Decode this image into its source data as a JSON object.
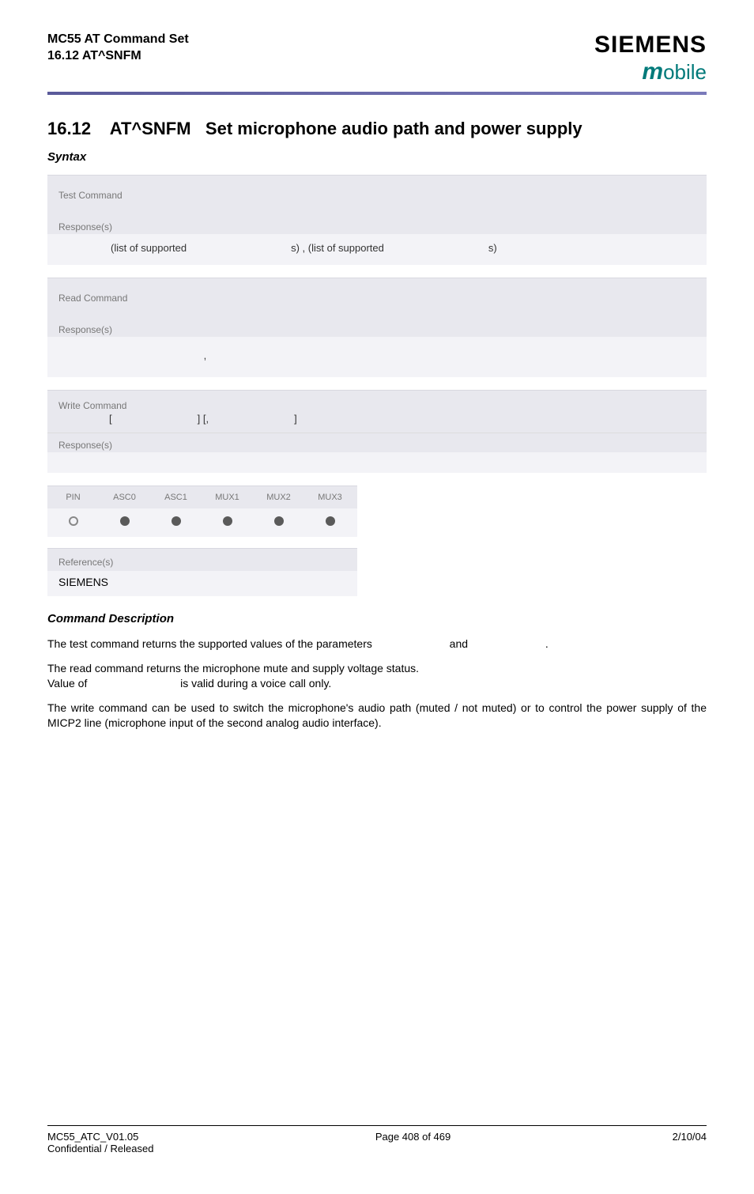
{
  "header": {
    "title_line1": "MC55 AT Command Set",
    "title_line2": "16.12 AT^SNFM",
    "brand": "SIEMENS",
    "subbrand_m": "m",
    "subbrand_rest": "obile"
  },
  "section": {
    "number": "16.12",
    "cmd": "AT^SNFM",
    "title_rest": "Set microphone audio path and power supply"
  },
  "labels": {
    "syntax": "Syntax",
    "test_command": "Test Command",
    "response": "Response(s)",
    "read_command": "Read Command",
    "write_command": "Write Command",
    "references": "Reference(s)",
    "command_description": "Command Description"
  },
  "test_response": {
    "seg1": "(list of supported",
    "seg2": "s) , (list of supported",
    "seg3": "s)"
  },
  "read_response": {
    "comma": ","
  },
  "write_command_params": {
    "open": "[",
    "mid": "] [,",
    "close": "]"
  },
  "pin_table": {
    "headers": [
      "PIN",
      "ASC0",
      "ASC1",
      "MUX1",
      "MUX2",
      "MUX3"
    ],
    "values": [
      "open",
      "filled",
      "filled",
      "filled",
      "filled",
      "filled"
    ]
  },
  "references_value": "SIEMENS",
  "description": {
    "p1a": "The test command returns the supported values of the parameters",
    "p1b": "and",
    "p1c": ".",
    "p2a": "The read command returns the microphone mute and supply voltage status.",
    "p2b_label": "Value of",
    "p2b_rest": "is valid during a voice call only.",
    "p3": "The write command can be used to switch the microphone's audio path (muted / not muted) or to control the power supply of the MICP2 line (microphone input of the second analog audio interface)."
  },
  "footer": {
    "left_line1": "MC55_ATC_V01.05",
    "left_line2": "Confidential / Released",
    "center": "Page 408 of 469",
    "right": "2/10/04"
  }
}
